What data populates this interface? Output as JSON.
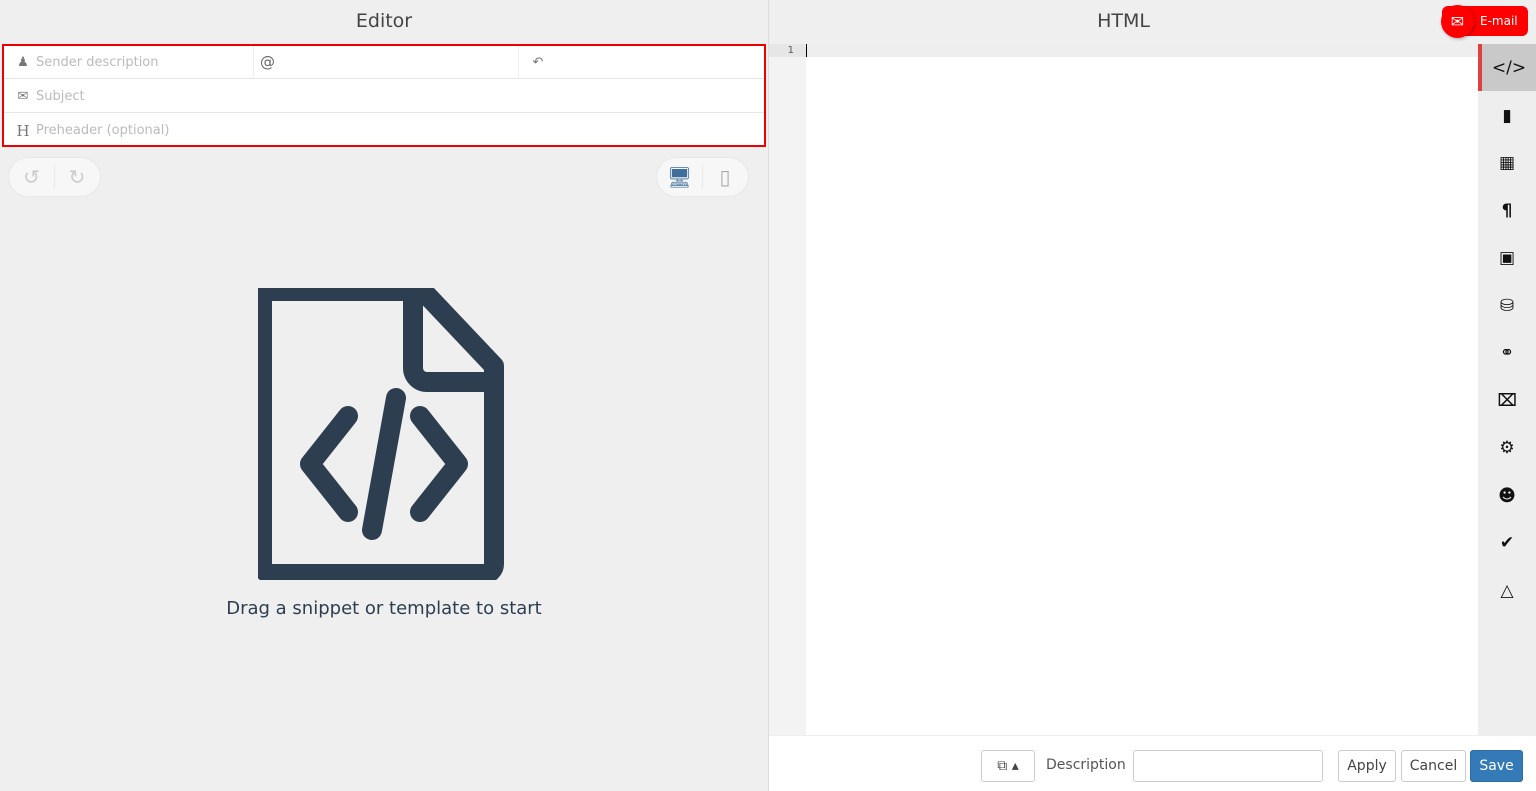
{
  "editor": {
    "title": "Editor",
    "sender_placeholder": "Sender description",
    "email_placeholder": "@",
    "reply_placeholder": "",
    "subject_placeholder": "Subject",
    "preheader_placeholder": "Preheader (optional)",
    "empty_message": "Drag a snippet or template to start"
  },
  "html": {
    "title": "HTML",
    "line_number": "1"
  },
  "email_button": "E-mail",
  "footer": {
    "description_label": "Description",
    "description_value": "",
    "apply": "Apply",
    "cancel": "Cancel",
    "save": "Save"
  },
  "sidebar": [
    "code",
    "file",
    "grid",
    "paragraph",
    "image",
    "database",
    "link",
    "rss",
    "settings",
    "users",
    "check",
    "flask"
  ],
  "colors": {
    "accent": "#e00000",
    "save": "#337ab7",
    "icon": "#2d3e50"
  }
}
